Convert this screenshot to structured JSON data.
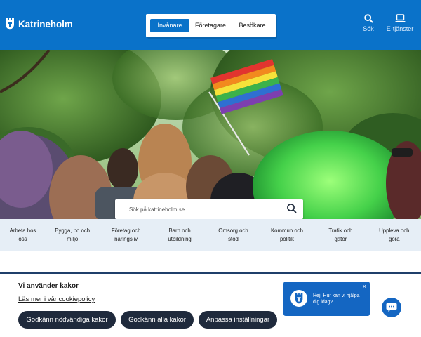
{
  "header": {
    "logo_text": "Katrineholm",
    "audience_tabs": [
      {
        "label": "Invånare",
        "active": true
      },
      {
        "label": "Företagare",
        "active": false
      },
      {
        "label": "Besökare",
        "active": false
      }
    ],
    "search_label": "Sök",
    "eservices_label": "E-tjänster"
  },
  "hero": {
    "search_placeholder": "Sök på katrineholm.se"
  },
  "categories": [
    {
      "line1": "Arbeta hos",
      "line2": "oss"
    },
    {
      "line1": "Bygga, bo och",
      "line2": "miljö"
    },
    {
      "line1": "Företag och",
      "line2": "näringsliv"
    },
    {
      "line1": "Barn och",
      "line2": "utbildning"
    },
    {
      "line1": "Omsorg och",
      "line2": "stöd"
    },
    {
      "line1": "Kommun och",
      "line2": "politik"
    },
    {
      "line1": "Trafik och",
      "line2": "gator"
    },
    {
      "line1": "Uppleva och",
      "line2": "göra"
    }
  ],
  "cookie": {
    "title": "Vi använder kakor",
    "policy_link": "Läs mer i vår cookiepolicy",
    "buttons": {
      "necessary": "Godkänn nödvändiga kakor",
      "all": "Godkänn alla kakor",
      "settings": "Anpassa inställningar"
    }
  },
  "chat": {
    "message": "Hej! Hur kan vi hjälpa dig idag?",
    "close_symbol": "×"
  },
  "colors": {
    "brand_blue": "#0a72c9",
    "category_bg": "#e6eef6",
    "cookie_button_bg": "#1f2a3c",
    "chat_blue": "#1466c2"
  },
  "icons": {
    "logo": "city-crest-icon",
    "search": "search-icon",
    "eservices": "laptop-icon",
    "chat": "chat-bubble-icon"
  }
}
